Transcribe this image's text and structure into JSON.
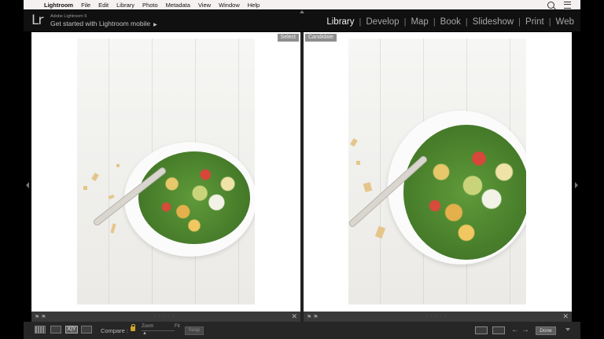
{
  "menubar": {
    "apple_icon": "apple-icon",
    "app_name": "Lightroom",
    "items": [
      "File",
      "Edit",
      "Library",
      "Photo",
      "Metadata",
      "View",
      "Window",
      "Help"
    ]
  },
  "identity": {
    "logo": "Lr",
    "small_text": "Adobe Lightroom 5",
    "main_text": "Get started with Lightroom mobile",
    "arrow": "▶"
  },
  "modules": {
    "active": "Library",
    "items": [
      "Library",
      "Develop",
      "Map",
      "Book",
      "Slideshow",
      "Print",
      "Web"
    ],
    "separator": "|"
  },
  "compare": {
    "select_tag": "Select",
    "candidate_tag": "Candidate"
  },
  "toolbar": {
    "compare_label": "Compare :",
    "compare_view_text": "X|Y",
    "zoom_label": "Zoom",
    "fit_label": "Fit",
    "swap_label": "Swap",
    "done_label": "Done"
  },
  "footer": {
    "flag_icons": "⚑ ⚑",
    "rating_dots": "· · · · ·",
    "close_glyph": "✕"
  },
  "colors": {
    "menubar_bg": "#f6f1f1",
    "active_module": "#f0f0f0",
    "inactive_module": "#a6a6a6",
    "tag_bg": "#8e8e8e",
    "lock": "#d2a52c"
  }
}
